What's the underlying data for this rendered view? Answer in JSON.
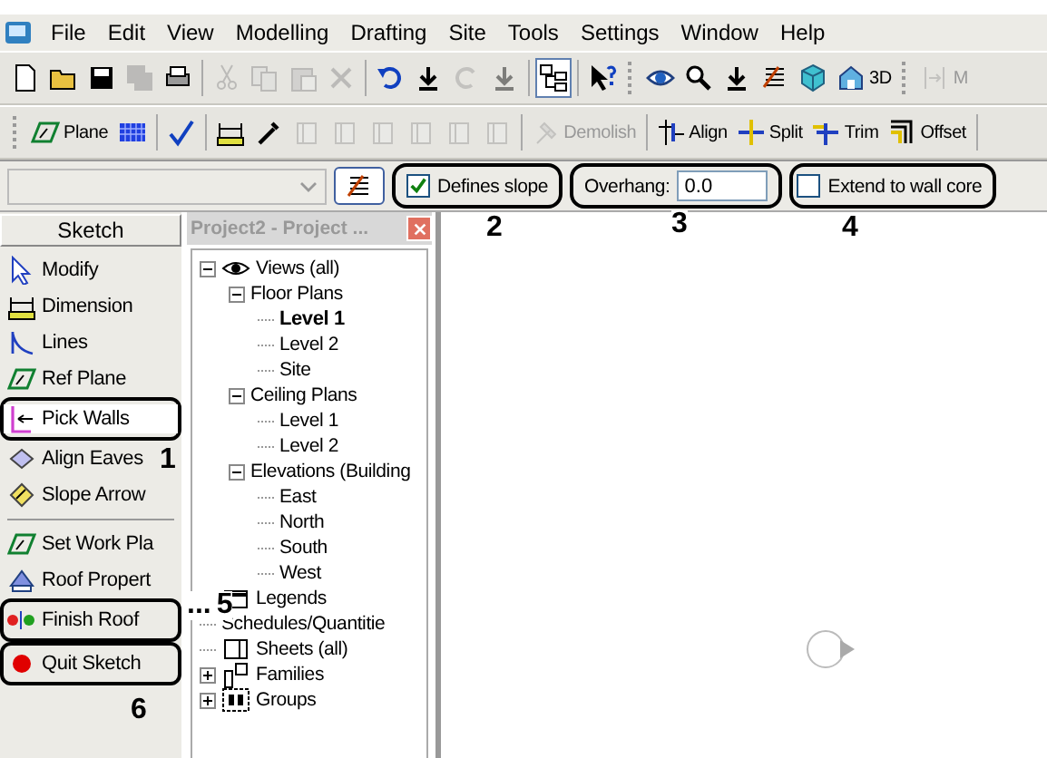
{
  "menu": [
    "File",
    "Edit",
    "View",
    "Modelling",
    "Drafting",
    "Site",
    "Tools",
    "Settings",
    "Window",
    "Help"
  ],
  "toolbar1": [
    {
      "kind": "button",
      "disabled": false,
      "pressed": false
    },
    {
      "kind": "button",
      "disabled": false,
      "pressed": false
    },
    {
      "kind": "button",
      "disabled": false,
      "pressed": false
    },
    {
      "kind": "button",
      "disabled": true,
      "pressed": false
    },
    {
      "kind": "button",
      "disabled": false,
      "pressed": false
    },
    {
      "kind": "separator"
    },
    {
      "kind": "button",
      "disabled": true,
      "pressed": false
    },
    {
      "kind": "button",
      "disabled": true,
      "pressed": false
    },
    {
      "kind": "button",
      "disabled": true,
      "pressed": false
    },
    {
      "kind": "button",
      "disabled": true,
      "pressed": false
    },
    {
      "kind": "separator"
    },
    {
      "kind": "button",
      "disabled": false,
      "pressed": false
    },
    {
      "kind": "button",
      "disabled": false,
      "pressed": false
    },
    {
      "kind": "button",
      "disabled": true,
      "pressed": false
    },
    {
      "kind": "button",
      "disabled": true,
      "pressed": false
    },
    {
      "kind": "separator"
    },
    {
      "kind": "button",
      "disabled": false,
      "pressed": true
    },
    {
      "kind": "separator"
    },
    {
      "kind": "button",
      "disabled": false,
      "pressed": false
    },
    {
      "kind": "gripper"
    },
    {
      "kind": "button",
      "disabled": false,
      "pressed": false
    },
    {
      "kind": "button",
      "disabled": false,
      "pressed": false
    },
    {
      "kind": "button",
      "disabled": false,
      "pressed": false
    },
    {
      "kind": "button",
      "disabled": false,
      "pressed": false
    },
    {
      "kind": "button",
      "disabled": false,
      "pressed": false
    },
    {
      "kind": "button",
      "label": "3D",
      "disabled": false,
      "pressed": false
    },
    {
      "kind": "gripper"
    },
    {
      "kind": "button",
      "label": "M",
      "disabled": true,
      "pressed": false
    }
  ],
  "toolbar2": [
    {
      "kind": "gripper"
    },
    {
      "kind": "button",
      "label": "Plane",
      "disabled": false
    },
    {
      "kind": "button",
      "disabled": false
    },
    {
      "kind": "separator"
    },
    {
      "kind": "button",
      "disabled": false
    },
    {
      "kind": "separator"
    },
    {
      "kind": "button",
      "disabled": false
    },
    {
      "kind": "button",
      "disabled": false
    },
    {
      "kind": "button",
      "disabled": true
    },
    {
      "kind": "button",
      "disabled": true
    },
    {
      "kind": "button",
      "disabled": true
    },
    {
      "kind": "button",
      "disabled": true
    },
    {
      "kind": "button",
      "disabled": true
    },
    {
      "kind": "button",
      "disabled": true
    },
    {
      "kind": "separator"
    },
    {
      "kind": "button",
      "label": "Demolish",
      "disabled": true
    },
    {
      "kind": "separator"
    },
    {
      "kind": "button",
      "label": "Align",
      "disabled": false
    },
    {
      "kind": "button",
      "label": "Split",
      "disabled": false
    },
    {
      "kind": "button",
      "label": "Trim",
      "disabled": false
    },
    {
      "kind": "button",
      "label": "Offset",
      "disabled": false
    },
    {
      "kind": "separator"
    }
  ],
  "options_bar": {
    "type_selector": {
      "disabled": true
    },
    "defines_slope": {
      "label": "Defines slope",
      "checked": true,
      "outlined": true
    },
    "overhang": {
      "label": "Overhang:",
      "value": "0.0",
      "outlined": true
    },
    "extend_to_wall_core": {
      "label": "Extend to wall core",
      "checked": false,
      "outlined": true
    }
  },
  "sketch_panel": {
    "title": "Sketch",
    "items": [
      {
        "kind": "tool",
        "label": "Modify",
        "selected": false,
        "outlined": false
      },
      {
        "kind": "tool",
        "label": "Dimension",
        "selected": false,
        "outlined": false
      },
      {
        "kind": "tool",
        "label": "Lines",
        "selected": false,
        "outlined": false
      },
      {
        "kind": "tool",
        "label": "Ref Plane",
        "selected": false,
        "outlined": false
      },
      {
        "kind": "tool",
        "label": "Pick Walls",
        "selected": true,
        "outlined": true
      },
      {
        "kind": "tool",
        "label": "Align Eaves",
        "selected": false,
        "outlined": false
      },
      {
        "kind": "tool",
        "label": "Slope Arrow",
        "selected": false,
        "outlined": false
      },
      {
        "kind": "separator"
      },
      {
        "kind": "tool",
        "label": "Set Work Pla",
        "selected": false,
        "outlined": false
      },
      {
        "kind": "tool",
        "label": "Roof Propert",
        "selected": false,
        "outlined": false
      },
      {
        "kind": "tool",
        "label": "Finish Roof",
        "selected": false,
        "outlined": true
      },
      {
        "kind": "tool",
        "label": "Quit Sketch",
        "selected": false,
        "outlined": true
      }
    ]
  },
  "project_browser": {
    "title": "Project2 - Project ...",
    "tree": [
      {
        "label": "Views (all)",
        "selected": false,
        "expanded": true,
        "children": [
          {
            "label": "Floor Plans",
            "selected": false,
            "expanded": true,
            "children": [
              {
                "label": "Level 1",
                "selected": true
              },
              {
                "label": "Level 2",
                "selected": false
              },
              {
                "label": "Site",
                "selected": false
              }
            ]
          },
          {
            "label": "Ceiling Plans",
            "selected": false,
            "expanded": true,
            "children": [
              {
                "label": "Level 1",
                "selected": false
              },
              {
                "label": "Level 2",
                "selected": false
              }
            ]
          },
          {
            "label": "Elevations (Building",
            "selected": false,
            "expanded": true,
            "children": [
              {
                "label": "East",
                "selected": false
              },
              {
                "label": "North",
                "selected": false
              },
              {
                "label": "South",
                "selected": false
              },
              {
                "label": "West",
                "selected": false
              }
            ]
          }
        ]
      },
      {
        "label": "Legends",
        "selected": false
      },
      {
        "label": "Schedules/Quantitie",
        "selected": false
      },
      {
        "label": "Sheets (all)",
        "selected": false
      },
      {
        "label": "Families",
        "selected": false,
        "expanded": false
      },
      {
        "label": "Groups",
        "selected": false,
        "expanded": false
      }
    ]
  },
  "callouts": [
    {
      "number": "1"
    },
    {
      "number": "2"
    },
    {
      "number": "3"
    },
    {
      "number": "4"
    },
    {
      "number": "5",
      "lead": "..."
    },
    {
      "number": "6"
    }
  ]
}
